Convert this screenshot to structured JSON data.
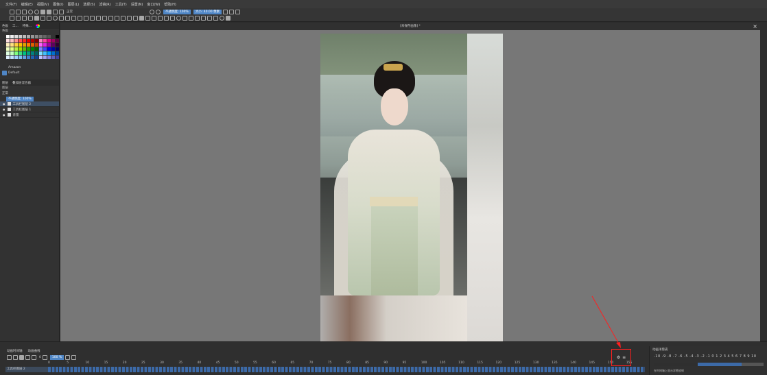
{
  "menubar": [
    "文件(F)",
    "编辑(E)",
    "视图(V)",
    "图像(I)",
    "图层(L)",
    "选择(S)",
    "滤镜(R)",
    "工具(T)",
    "设置(N)",
    "窗口(W)",
    "帮助(H)"
  ],
  "tool_options": {
    "blend_mode": "正常",
    "opacity": "不透明度: 100%",
    "size": "大小: 40.00 像素"
  },
  "canvas": {
    "doc_title": "[未保存画像] *"
  },
  "left_panel": {
    "tabs": [
      "色板",
      "工...",
      "特殊...",
      "..."
    ],
    "palette_title": "色板",
    "palette_name": "Amazon",
    "preset": "Default",
    "layer_tabs": [
      "图层",
      "叠加层混合器"
    ],
    "layer_panel_title": "图层",
    "blend_mode": "正常",
    "opacity": "不透明度: 100%",
    "layers": [
      {
        "name": "工具栏图层 2",
        "active": true
      },
      {
        "name": "工具栏图层 1",
        "active": false
      },
      {
        "name": "背景",
        "active": false
      }
    ]
  },
  "swatch_colors": [
    "#ffffff",
    "#eeeeee",
    "#dddddd",
    "#cccccc",
    "#bbbbbb",
    "#aaaaaa",
    "#999999",
    "#888888",
    "#777777",
    "#666666",
    "#555555",
    "#333333",
    "#000000",
    "#ffe0e0",
    "#ffc0c0",
    "#ff9090",
    "#ff5050",
    "#ff2020",
    "#e00000",
    "#b00000",
    "#800000",
    "#ff80c0",
    "#ff40a0",
    "#e00080",
    "#a00060",
    "#600040",
    "#fff0c0",
    "#ffe080",
    "#ffd040",
    "#ffc000",
    "#e0a000",
    "#ff8000",
    "#e06000",
    "#c04000",
    "#ff60ff",
    "#e020e0",
    "#a000a0",
    "#600060",
    "#300030",
    "#f0ffc0",
    "#e0ff80",
    "#c0f040",
    "#a0e000",
    "#60c000",
    "#20a000",
    "#008000",
    "#006000",
    "#8080ff",
    "#4040ff",
    "#0000e0",
    "#0000a0",
    "#000060",
    "#e0ffe0",
    "#c0ffc0",
    "#80ff80",
    "#40e080",
    "#00c080",
    "#00a080",
    "#008080",
    "#006060",
    "#80e0ff",
    "#40c0ff",
    "#00a0ff",
    "#0070d0",
    "#004090",
    "#e0f0ff",
    "#c0e0ff",
    "#a0d0ff",
    "#80c0f0",
    "#60a0e0",
    "#4080d0",
    "#2060b0",
    "#104090",
    "#c0c0ff",
    "#a0a0f0",
    "#8080e0",
    "#6060c0",
    "#4040a0"
  ],
  "timeline": {
    "tabs": [
      "动画时间轴",
      "动画曲线"
    ],
    "layer_name": "工具栏图层 2",
    "play_label": "0",
    "zoom": "100 %",
    "ruler": [
      "0",
      "5",
      "10",
      "15",
      "20",
      "25",
      "30",
      "35",
      "40",
      "45",
      "50",
      "55",
      "60",
      "65",
      "70",
      "75",
      "80",
      "85",
      "90",
      "95",
      "100",
      "105",
      "110",
      "115",
      "120",
      "125",
      "130",
      "135",
      "140",
      "145",
      "150",
      "155"
    ],
    "menu_button_icons": [
      "settings-icon",
      "hamburger-menu-icon"
    ],
    "onion": {
      "title": "动画洋葱皮",
      "numbers": "-10 -9 -8 -7 -6 -5 -4 -3 -2 -1  0  1  2  3  4  5  6  7  8  9 10",
      "note": "在时间轴上显示洋葱皮帧"
    }
  },
  "annotation_color": "#ff1f1f"
}
